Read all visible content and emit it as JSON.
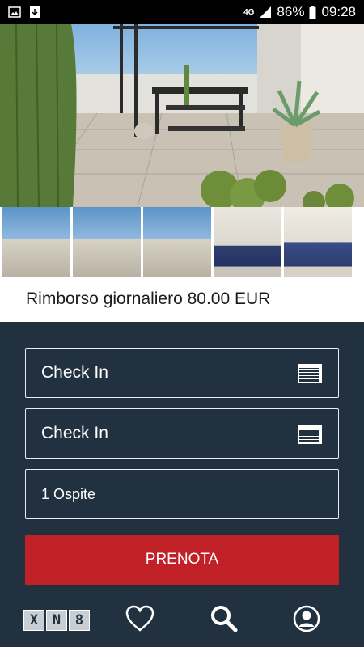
{
  "status_bar": {
    "network": "4G",
    "battery": "86%",
    "time": "09:28"
  },
  "listing": {
    "price_text": "Rimborso giornaliero 80.00 EUR",
    "photos": [
      {
        "name": "terrace-main"
      },
      {
        "name": "terrace-1"
      },
      {
        "name": "terrace-2"
      },
      {
        "name": "terrace-3"
      },
      {
        "name": "bedroom-1"
      },
      {
        "name": "bedroom-2"
      }
    ]
  },
  "form": {
    "check_in_1": "Check In",
    "check_in_2": "Check In",
    "guests": "1 Ospite",
    "book_label": "PRENOTA"
  },
  "nav": {
    "logo_letters": [
      "X",
      "N",
      "8"
    ],
    "items": [
      "heart-icon",
      "search-icon",
      "profile-icon"
    ]
  },
  "colors": {
    "background": "#22313f",
    "accent": "#c12026"
  }
}
